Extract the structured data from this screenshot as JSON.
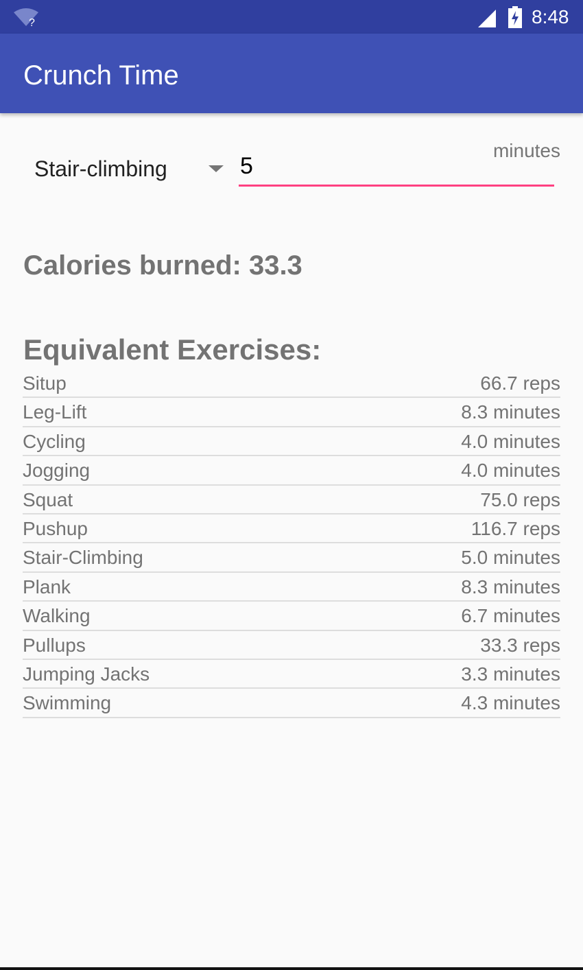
{
  "status_bar": {
    "time": "8:48",
    "background": "#303f9f",
    "icons": [
      "wifi-unknown-icon",
      "cell-signal-icon",
      "battery-charging-icon"
    ]
  },
  "app_bar": {
    "title": "Crunch Time",
    "background": "#3f51b5"
  },
  "form": {
    "exercise_selected": "Stair-climbing",
    "minutes_hint": "minutes",
    "minutes_value": "5",
    "accent": "#ff4081"
  },
  "calories": {
    "text": "Calories burned: 33.3"
  },
  "equivalents": {
    "heading": "Equivalent Exercises:",
    "items": [
      {
        "name": "Situp",
        "value": "66.7 reps"
      },
      {
        "name": "Leg-Lift",
        "value": "8.3 minutes"
      },
      {
        "name": "Cycling",
        "value": "4.0 minutes"
      },
      {
        "name": "Jogging",
        "value": "4.0 minutes"
      },
      {
        "name": "Squat",
        "value": "75.0 reps"
      },
      {
        "name": "Pushup",
        "value": "116.7 reps"
      },
      {
        "name": "Stair-Climbing",
        "value": "5.0 minutes"
      },
      {
        "name": "Plank",
        "value": "8.3 minutes"
      },
      {
        "name": "Walking",
        "value": "6.7 minutes"
      },
      {
        "name": "Pullups",
        "value": "33.3 reps"
      },
      {
        "name": "Jumping Jacks",
        "value": "3.3 minutes"
      },
      {
        "name": "Swimming",
        "value": "4.3 minutes"
      }
    ]
  }
}
